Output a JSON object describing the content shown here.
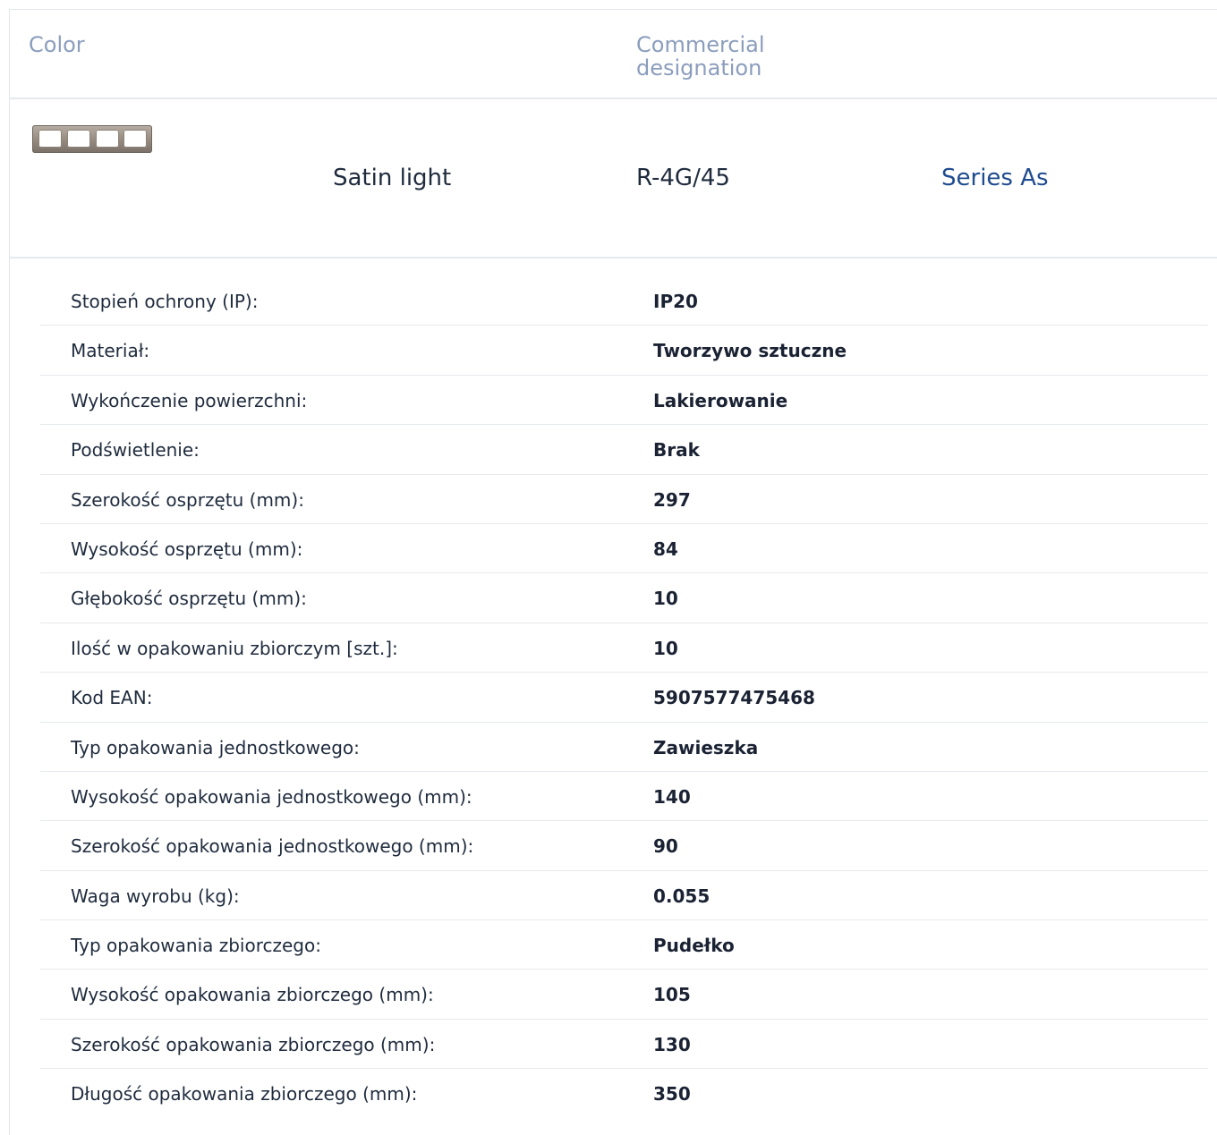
{
  "header": {
    "color_label": "Color",
    "commercial_label": "Commercial designation"
  },
  "product": {
    "color_name": "Satin light",
    "code": "R-4G/45",
    "series": "Series As",
    "swatch_icon": "frame-4-gang-icon",
    "swatch_color": "#948a80"
  },
  "specs": [
    {
      "label": "Stopień ochrony (IP):",
      "value": "IP20"
    },
    {
      "label": "Materiał:",
      "value": "Tworzywo sztuczne"
    },
    {
      "label": "Wykończenie powierzchni:",
      "value": "Lakierowanie"
    },
    {
      "label": "Podświetlenie:",
      "value": "Brak"
    },
    {
      "label": "Szerokość osprzętu (mm):",
      "value": "297"
    },
    {
      "label": "Wysokość osprzętu (mm):",
      "value": "84"
    },
    {
      "label": "Głębokość osprzętu (mm):",
      "value": "10"
    },
    {
      "label": "Ilość w opakowaniu zbiorczym [szt.]:",
      "value": "10"
    },
    {
      "label": "Kod EAN:",
      "value": "5907577475468"
    },
    {
      "label": "Typ opakowania jednostkowego:",
      "value": "Zawieszka"
    },
    {
      "label": "Wysokość opakowania jednostkowego (mm):",
      "value": "140"
    },
    {
      "label": "Szerokość opakowania jednostkowego (mm):",
      "value": "90"
    },
    {
      "label": "Waga wyrobu (kg):",
      "value": "0.055"
    },
    {
      "label": "Typ opakowania zbiorczego:",
      "value": "Pudełko"
    },
    {
      "label": "Wysokość opakowania zbiorczego (mm):",
      "value": "105"
    },
    {
      "label": "Szerokość opakowania zbiorczego (mm):",
      "value": "130"
    },
    {
      "label": "Długość opakowania zbiorczego (mm):",
      "value": "350"
    }
  ]
}
